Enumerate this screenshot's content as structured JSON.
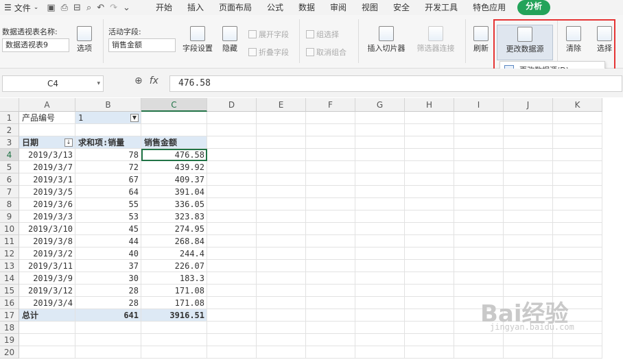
{
  "menubar": {
    "file_label": "文件",
    "tabs": [
      "开始",
      "插入",
      "页面布局",
      "公式",
      "数据",
      "审阅",
      "视图",
      "安全",
      "开发工具",
      "特色应用"
    ],
    "active_tab": "分析"
  },
  "ribbon": {
    "pivot_name_label": "数据透视表名称:",
    "pivot_name_value": "数据透视表9",
    "options_label": "选项",
    "active_field_label": "活动字段:",
    "active_field_value": "销售金额",
    "field_settings_label": "字段设置",
    "hide_label": "隐藏",
    "expand_field_label": "展开字段",
    "collapse_field_label": "折叠字段",
    "group_select_label": "组选择",
    "ungroup_label": "取消组合",
    "insert_slicer_label": "插入切片器",
    "filter_connection_label": "筛选器连接",
    "refresh_label": "刷新",
    "change_source_label": "更改数据源",
    "clear_label": "清除",
    "select_label": "选择",
    "dropdown_item_label": "更改数据源(D)..."
  },
  "formula_bar": {
    "name_box": "C4",
    "fx_label": "fx",
    "value": "476.58"
  },
  "sheet": {
    "columns": [
      "A",
      "B",
      "C",
      "D",
      "E",
      "F",
      "G",
      "H",
      "I",
      "J",
      "K"
    ],
    "rows": [
      "1",
      "2",
      "3",
      "4",
      "5",
      "6",
      "7",
      "8",
      "9",
      "10",
      "11",
      "12",
      "13",
      "14",
      "15",
      "16",
      "17",
      "18",
      "19",
      "20"
    ],
    "filter_label": "产品编号",
    "filter_value": "1",
    "header_date": "日期",
    "header_qty": "求和项:销量",
    "header_amount": "销售金额",
    "data": [
      {
        "date": "2019/3/13",
        "qty": "78",
        "amount": "476.58"
      },
      {
        "date": "2019/3/7",
        "qty": "72",
        "amount": "439.92"
      },
      {
        "date": "2019/3/1",
        "qty": "67",
        "amount": "409.37"
      },
      {
        "date": "2019/3/5",
        "qty": "64",
        "amount": "391.04"
      },
      {
        "date": "2019/3/6",
        "qty": "55",
        "amount": "336.05"
      },
      {
        "date": "2019/3/3",
        "qty": "53",
        "amount": "323.83"
      },
      {
        "date": "2019/3/10",
        "qty": "45",
        "amount": "274.95"
      },
      {
        "date": "2019/3/8",
        "qty": "44",
        "amount": "268.84"
      },
      {
        "date": "2019/3/2",
        "qty": "40",
        "amount": "244.4"
      },
      {
        "date": "2019/3/11",
        "qty": "37",
        "amount": "226.07"
      },
      {
        "date": "2019/3/9",
        "qty": "30",
        "amount": "183.3"
      },
      {
        "date": "2019/3/12",
        "qty": "28",
        "amount": "171.08"
      },
      {
        "date": "2019/3/4",
        "qty": "28",
        "amount": "171.08"
      }
    ],
    "total_label": "总计",
    "total_qty": "641",
    "total_amount": "3916.51"
  },
  "watermark": {
    "brand": "Bai经验",
    "url": "jingyan.baidu.com"
  }
}
